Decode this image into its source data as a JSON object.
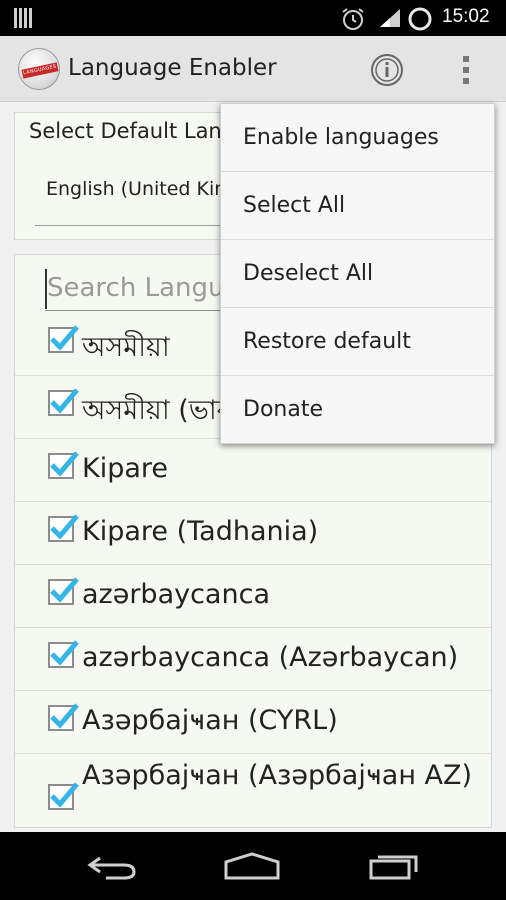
{
  "status_bar": {
    "time": "15:02"
  },
  "action_bar": {
    "title": "Language Enabler",
    "app_icon_text": "LANGUAGES"
  },
  "default_language": {
    "title": "Select Default Language",
    "selected": "English (United Kingdom)"
  },
  "search": {
    "placeholder": "Search Languages"
  },
  "languages": [
    {
      "label": "অসমীয়া",
      "checked": true
    },
    {
      "label": "অসমীয়া (ভাৰত)",
      "checked": true
    },
    {
      "label": "Kipare",
      "checked": true
    },
    {
      "label": "Kipare (Tadhania)",
      "checked": true
    },
    {
      "label": "azərbaycanca",
      "checked": true
    },
    {
      "label": "azərbaycanca (Azərbaycan)",
      "checked": true
    },
    {
      "label": "Азәрбајҹан (CYRL)",
      "checked": true
    },
    {
      "label": "Азәрбајҹан (Азәрбајҹан AZ)",
      "checked": true
    }
  ],
  "menu": {
    "items": [
      "Enable languages",
      "Select All",
      "Deselect All",
      "Restore default",
      "Donate"
    ]
  },
  "colors": {
    "check_accent": "#33b5e5",
    "status_bar": "#000000",
    "action_bar": "#e4e4e4"
  }
}
